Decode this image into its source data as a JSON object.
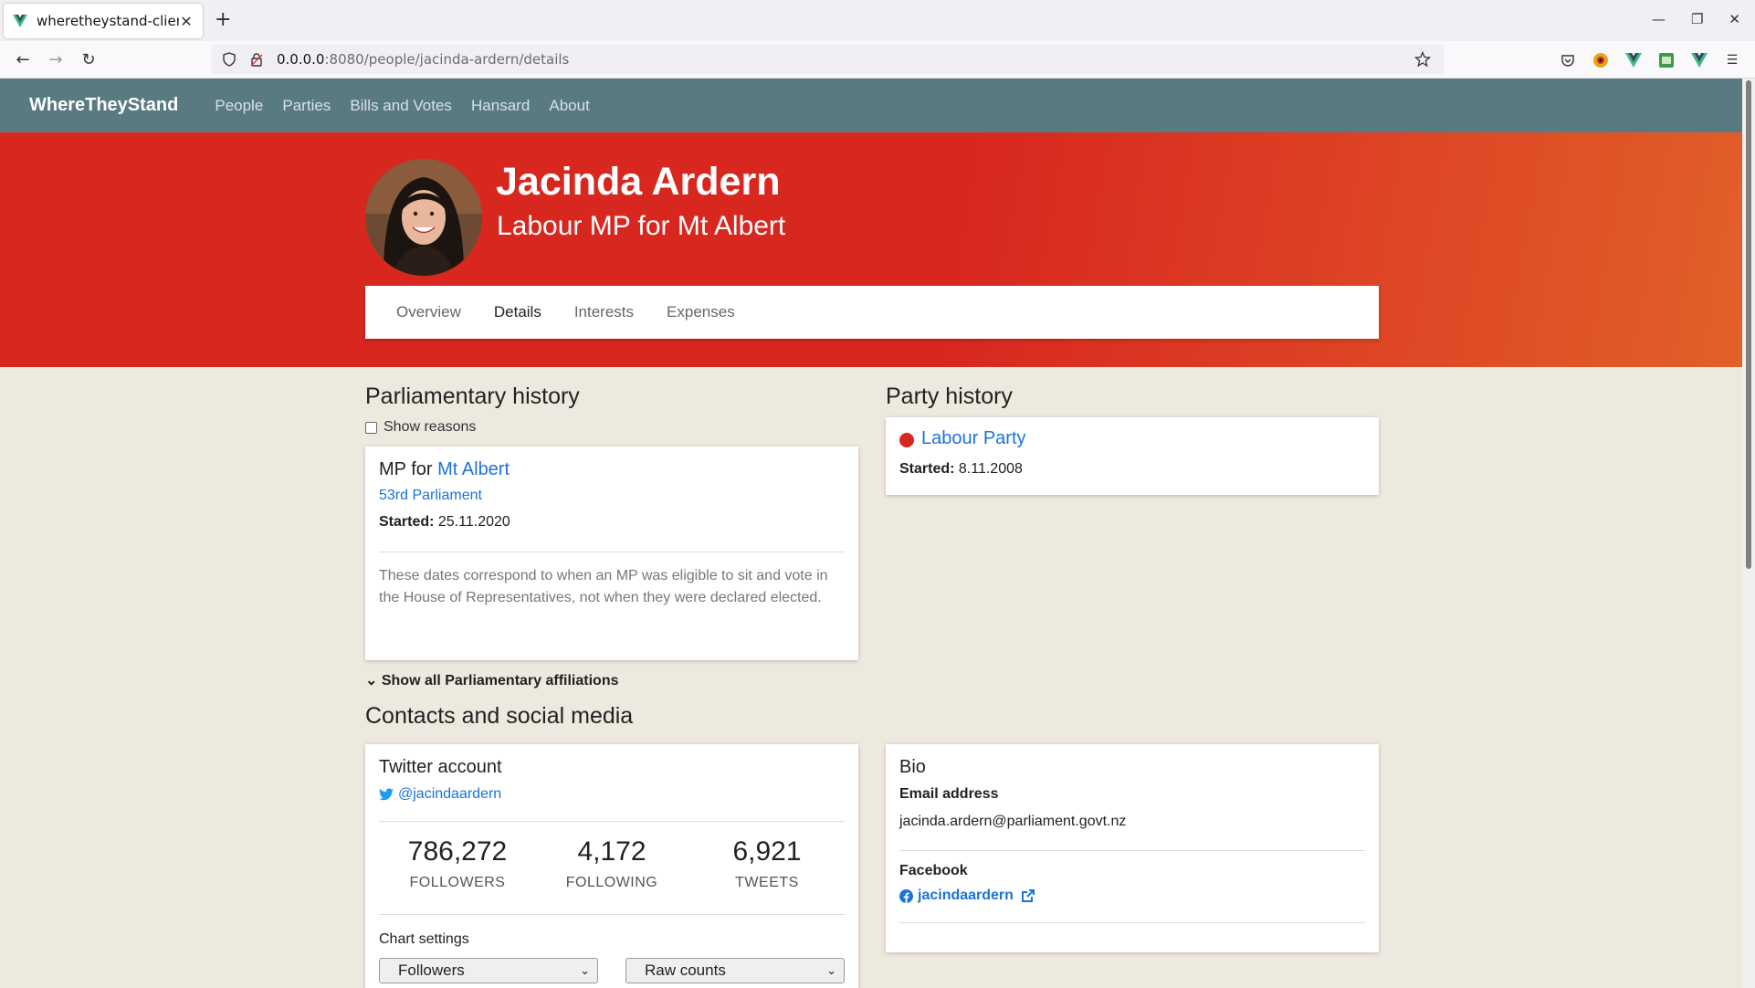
{
  "browser": {
    "tab_title": "wheretheystand-client",
    "url_host": "0.0.0.0",
    "url_rest": ":8080/people/jacinda-ardern/details",
    "new_tab": "+",
    "close": "✕"
  },
  "site": {
    "brand": "WhereTheyStand",
    "nav": [
      "People",
      "Parties",
      "Bills and Votes",
      "Hansard",
      "About"
    ]
  },
  "person": {
    "name": "Jacinda Ardern",
    "role": "Labour MP for Mt Albert",
    "tabs": [
      "Overview",
      "Details",
      "Interests",
      "Expenses"
    ],
    "active_tab": "Details"
  },
  "parliamentary": {
    "heading": "Parliamentary history",
    "show_reasons": "Show reasons",
    "mp_for_prefix": "MP for",
    "electorate": "Mt Albert",
    "parliament": "53rd Parliament",
    "started_label": "Started:",
    "started_value": "25.11.2020",
    "note": "These dates correspond to when an MP was eligible to sit and vote in the House of Representatives, not when they were declared elected.",
    "show_all": "Show all Parliamentary affiliations"
  },
  "party": {
    "heading": "Party history",
    "name": "Labour Party",
    "color": "#d8271f",
    "started_label": "Started:",
    "started_value": "8.11.2008"
  },
  "contacts": {
    "heading": "Contacts and social media",
    "twitter": {
      "title": "Twitter account",
      "handle": "@jacindaardern",
      "followers": "786,272",
      "followers_label": "FOLLOWERS",
      "following": "4,172",
      "following_label": "FOLLOWING",
      "tweets": "6,921",
      "tweets_label": "TWEETS",
      "chart_settings": "Chart settings",
      "metric": "Followers",
      "mode": "Raw counts"
    },
    "bio": {
      "title": "Bio",
      "email_label": "Email address",
      "email": "jacinda.ardern@parliament.govt.nz",
      "facebook_label": "Facebook",
      "facebook": "jacindaardern"
    }
  }
}
